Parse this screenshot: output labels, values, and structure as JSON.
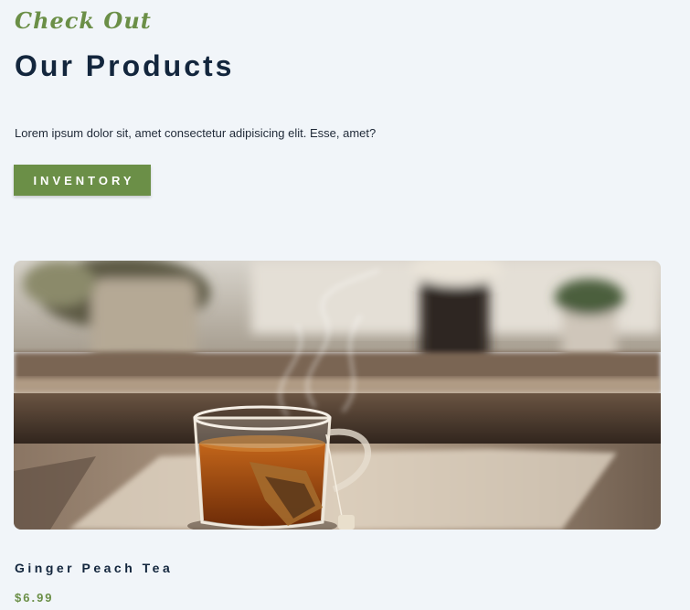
{
  "header": {
    "eyebrow": "Check Out",
    "title": "Our Products",
    "description": "Lorem ipsum dolor sit, amet consectetur adipisicing elit. Esse, amet?",
    "button_label": "INVENTORY"
  },
  "product": {
    "name": "Ginger Peach Tea",
    "price": "$6.99",
    "image_icon": "tea-cup-photo"
  },
  "colors": {
    "accent": "#6b8f47",
    "heading": "#13263d",
    "background": "#f1f5f9"
  }
}
